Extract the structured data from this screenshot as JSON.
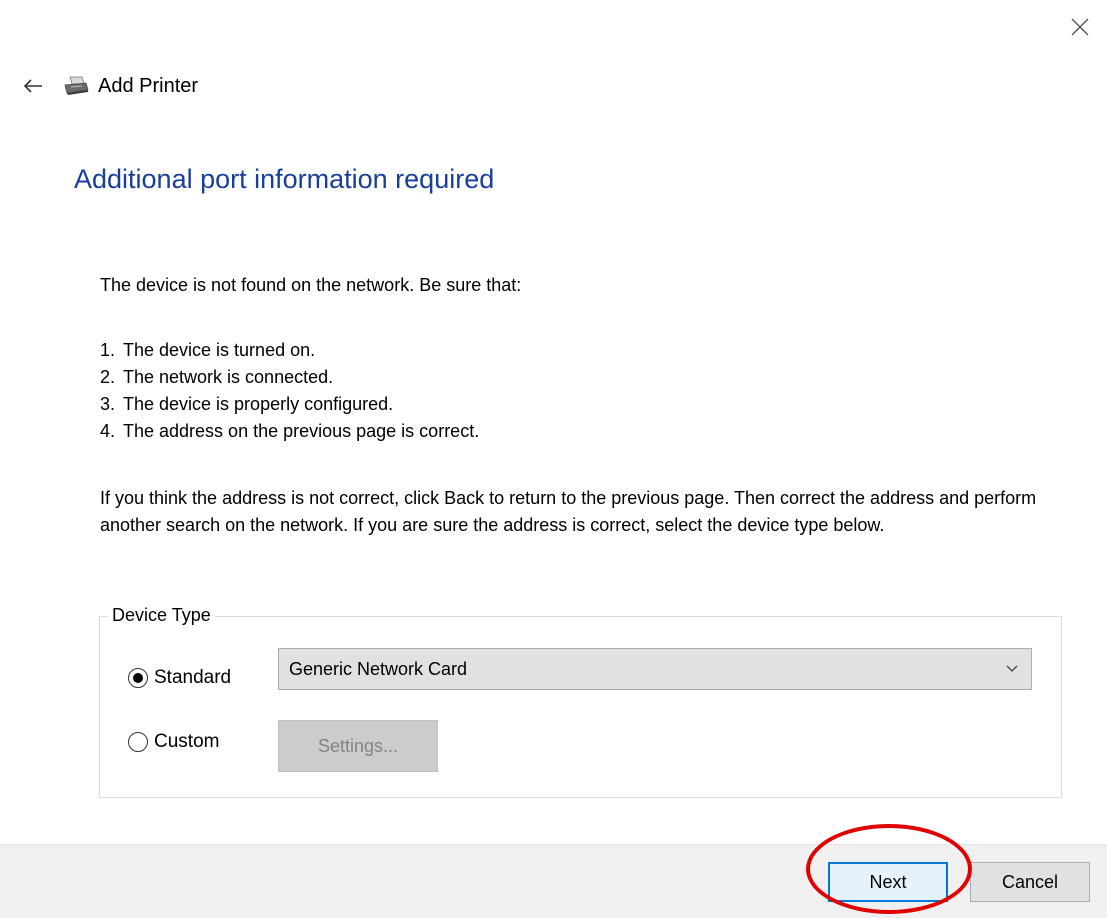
{
  "window": {
    "title": "Add Printer",
    "close_icon": "close-icon",
    "back_icon": "back-arrow-icon",
    "app_icon": "printer-icon"
  },
  "heading": "Additional port information required",
  "intro": "The device is not found on the network.  Be sure that:",
  "checklist": [
    {
      "num": "1.",
      "text": "The device is turned on."
    },
    {
      "num": "2.",
      "text": "The network is connected."
    },
    {
      "num": "3.",
      "text": "The device is properly configured."
    },
    {
      "num": "4.",
      "text": "The address on the previous page is correct."
    }
  ],
  "paragraph": "If you think the address is not correct, click Back to return to the previous page.  Then correct the address and perform another search on the network.  If you are sure the address is correct, select the device type below.",
  "device_type": {
    "legend": "Device Type",
    "standard_label": "Standard",
    "standard_selected": true,
    "custom_label": "Custom",
    "custom_selected": false,
    "select_value": "Generic Network Card",
    "settings_label": "Settings..."
  },
  "footer": {
    "next_label": "Next",
    "cancel_label": "Cancel"
  },
  "colors": {
    "heading": "#1a3e9b",
    "focus_border": "#0078d7",
    "annotation": "#e00000"
  }
}
